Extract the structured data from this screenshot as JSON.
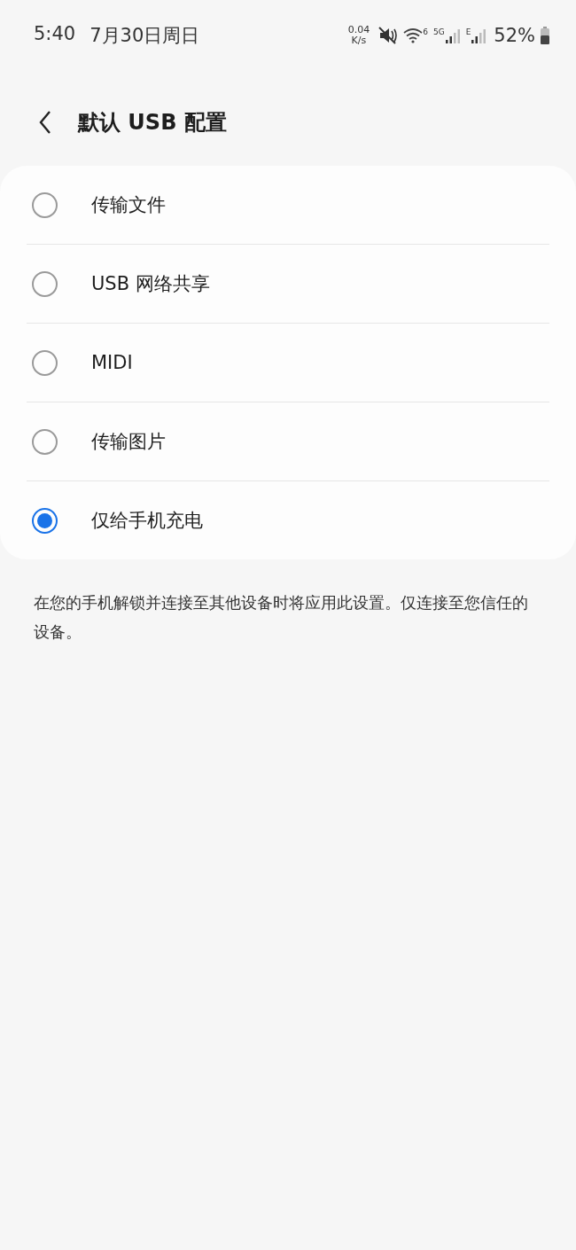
{
  "status_bar": {
    "time": "5:40",
    "date": "7月30日周日",
    "net_speed_value": "0.04",
    "net_speed_unit": "K/s",
    "wifi_badge": "6",
    "sim1_badge": "5G",
    "sim2_badge": "E",
    "battery": "52%"
  },
  "header": {
    "title": "默认 USB 配置"
  },
  "options": [
    {
      "label": "传输文件",
      "selected": false
    },
    {
      "label": "USB 网络共享",
      "selected": false
    },
    {
      "label": "MIDI",
      "selected": false
    },
    {
      "label": "传输图片",
      "selected": false
    },
    {
      "label": "仅给手机充电",
      "selected": true
    }
  ],
  "description": "在您的手机解锁并连接至其他设备时将应用此设置。仅连接至您信任的设备。"
}
